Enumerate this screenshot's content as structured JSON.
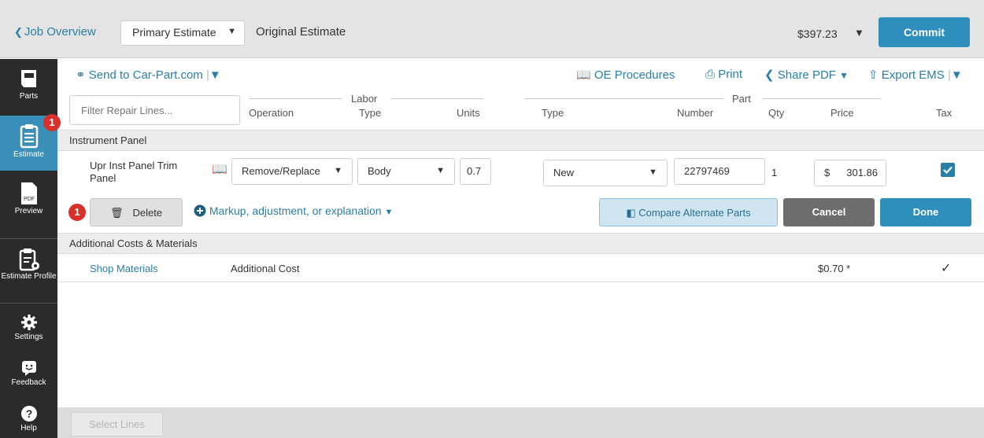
{
  "header": {
    "back_label": "Job Overview",
    "estimate_select": "Primary Estimate",
    "estimate_name": "Original Estimate",
    "total": "$397.23",
    "commit_label": "Commit"
  },
  "sidebar": {
    "items": [
      {
        "label": "Parts"
      },
      {
        "label": "Estimate",
        "badge": "1"
      },
      {
        "label": "Preview",
        "icon_text": "PDF"
      },
      {
        "label": "Estimate Profile"
      },
      {
        "label": "Settings"
      },
      {
        "label": "Feedback"
      },
      {
        "label": "Help"
      }
    ]
  },
  "toolbar": {
    "send_label": "Send to Car-Part.com",
    "oe_label": "OE Procedures",
    "print_label": "Print",
    "share_label": "Share PDF",
    "export_label": "Export EMS"
  },
  "filter": {
    "placeholder": "Filter Repair Lines..."
  },
  "columns": {
    "operation": "Operation",
    "labor_group": "Labor",
    "labor_type": "Type",
    "units": "Units",
    "part_group": "Part",
    "part_type": "Type",
    "number": "Number",
    "qty": "Qty",
    "price": "Price",
    "tax": "Tax"
  },
  "sections": {
    "instrument_panel": "Instrument Panel",
    "additional": "Additional Costs & Materials"
  },
  "edit_line": {
    "description": "Upr Inst Panel Trim Panel",
    "operation": "Remove/Replace",
    "labor_type": "Body",
    "units": "0.7",
    "part_type": "New",
    "part_number": "22797469",
    "qty": "1",
    "currency": "$",
    "price": "301.86",
    "tax_checked": true
  },
  "actions": {
    "badge": "1",
    "delete_label": "Delete",
    "markup_label": "Markup, adjustment, or explanation",
    "compare_label": "Compare Alternate Parts",
    "cancel_label": "Cancel",
    "done_label": "Done"
  },
  "additional_row": {
    "name": "Shop Materials",
    "type": "Additional Cost",
    "price": "$0.70 *",
    "tax_mark": "✓"
  },
  "footer": {
    "select_lines_label": "Select Lines"
  },
  "colors": {
    "accent": "#2f8fbc",
    "link": "#2a7fa8",
    "sidebar_bg": "#2b2b2b",
    "badge": "#d9302c"
  }
}
